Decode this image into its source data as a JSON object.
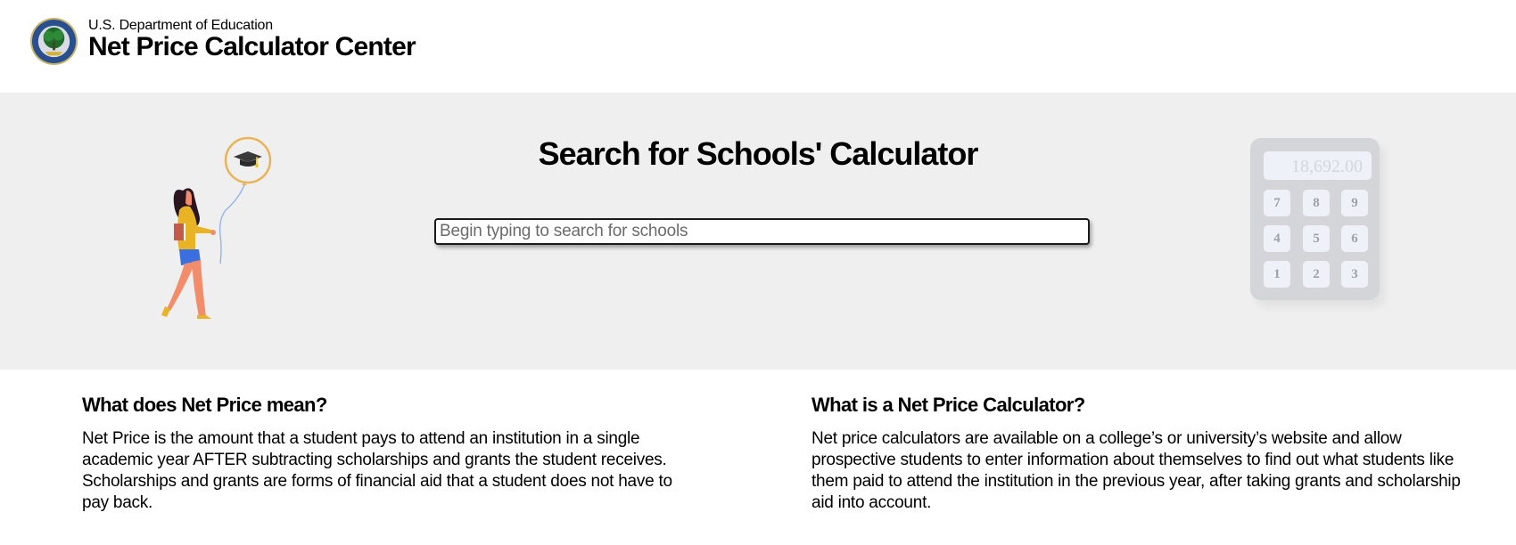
{
  "header": {
    "agency": "U.S. Department of Education",
    "title": "Net Price Calculator Center",
    "logo_icon": "department-of-education-seal"
  },
  "hero": {
    "title": "Search for Schools' Calculator",
    "search": {
      "placeholder": "Begin typing to search for schools",
      "value": ""
    },
    "illustration": {
      "description": "student-with-graduation-balloon",
      "balloon_icon": "graduation-cap-icon"
    },
    "calculator_graphic": {
      "display": "18,692.00",
      "keys": [
        "7",
        "8",
        "9",
        "4",
        "5",
        "6",
        "1",
        "2",
        "3"
      ]
    }
  },
  "info": {
    "net_price": {
      "heading": "What does Net Price mean?",
      "body": "Net Price is the amount that a student pays to attend an institution in a single academic year AFTER subtracting scholarships and grants the student receives. Scholarships and grants are forms of financial aid that a student does not have to pay back."
    },
    "calculator": {
      "heading": "What is a Net Price Calculator?",
      "body": "Net price calculators are available on a college’s or university’s website and allow prospective students to enter information about themselves to find out what students like them paid to attend the institution in the previous year, after taking grants and scholarship aid into account."
    }
  },
  "colors": {
    "hero_background": "#efefef",
    "balloon": "#e8b457",
    "sweater": "#e8b425",
    "shorts": "#3b6fe0",
    "skin": "#f28c6a",
    "hair": "#2a1620",
    "calculator_body": "#d3d5d8"
  }
}
